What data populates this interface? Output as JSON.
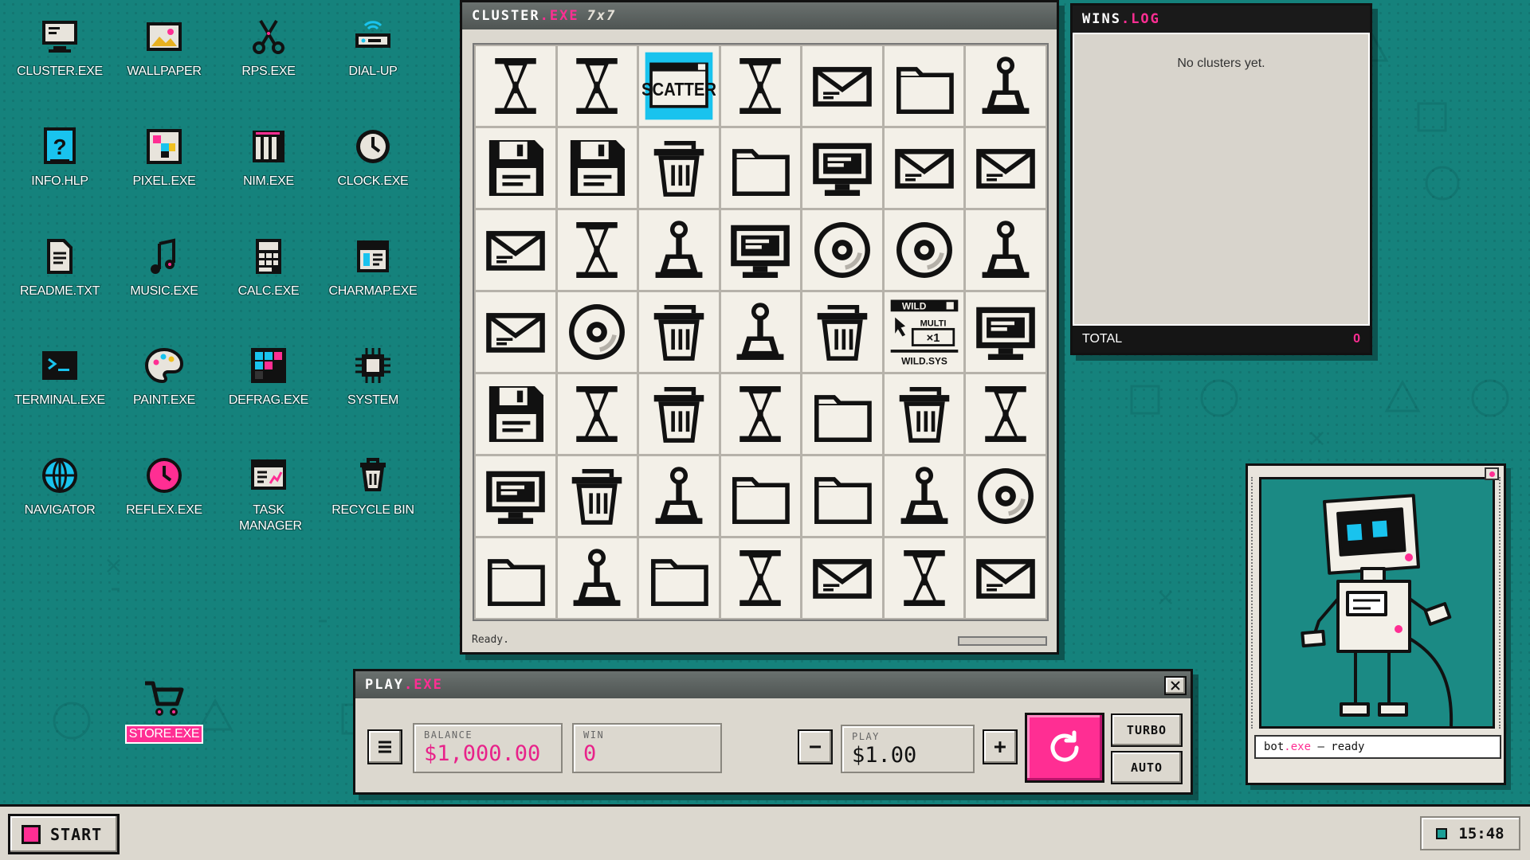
{
  "desktop": {
    "icons": [
      {
        "label": "CLUSTER.EXE",
        "icon": "monitor-icon"
      },
      {
        "label": "WALLPAPER",
        "icon": "image-icon"
      },
      {
        "label": "RPS.EXE",
        "icon": "scissors-icon"
      },
      {
        "label": "DIAL-UP",
        "icon": "modem-icon"
      },
      {
        "label": "INFO.HLP",
        "icon": "help-icon"
      },
      {
        "label": "PIXEL.EXE",
        "icon": "pixel-icon"
      },
      {
        "label": "NIM.EXE",
        "icon": "nim-icon"
      },
      {
        "label": "CLOCK.EXE",
        "icon": "clock-icon"
      },
      {
        "label": "README.TXT",
        "icon": "document-icon"
      },
      {
        "label": "MUSIC.EXE",
        "icon": "music-note-icon"
      },
      {
        "label": "CALC.EXE",
        "icon": "calculator-icon"
      },
      {
        "label": "CHARMAP.EXE",
        "icon": "charmap-icon"
      },
      {
        "label": "TERMINAL.EXE",
        "icon": "terminal-icon"
      },
      {
        "label": "PAINT.EXE",
        "icon": "palette-icon"
      },
      {
        "label": "DEFRAG.EXE",
        "icon": "defrag-icon"
      },
      {
        "label": "SYSTEM",
        "icon": "chip-icon"
      },
      {
        "label": "NAVIGATOR",
        "icon": "globe-icon"
      },
      {
        "label": "REFLEX.EXE",
        "icon": "reflex-clock-icon"
      },
      {
        "label": "TASK MANAGER",
        "icon": "task-manager-icon"
      },
      {
        "label": "RECYCLE BIN",
        "icon": "trash-icon"
      },
      {
        "label": "STORE.EXE",
        "icon": "cart-icon",
        "selected": true
      }
    ]
  },
  "cluster": {
    "title": "CLUSTER",
    "title_ext": ".EXE",
    "size_label": "7x7",
    "status": "Ready.",
    "symbols": {
      "scatter_label": "SCATTER",
      "wild_top": "WILD",
      "wild_multi": "MULTI",
      "wild_mult_value": "×1",
      "wild_bottom": "WILD.SYS"
    },
    "grid": [
      [
        "hourglass",
        "hourglass",
        "scatter",
        "hourglass",
        "mail",
        "folder",
        "joystick"
      ],
      [
        "floppy",
        "floppy",
        "trash",
        "folder",
        "monitor",
        "mail",
        "mail"
      ],
      [
        "mail",
        "hourglass",
        "joystick",
        "monitor",
        "cd",
        "cd",
        "joystick"
      ],
      [
        "mail",
        "cd",
        "trash",
        "joystick",
        "trash",
        "wild",
        "monitor"
      ],
      [
        "floppy",
        "hourglass",
        "trash",
        "hourglass",
        "folder",
        "trash",
        "hourglass"
      ],
      [
        "monitor",
        "trash",
        "joystick",
        "folder",
        "folder",
        "joystick",
        "cd"
      ],
      [
        "folder",
        "joystick",
        "folder",
        "hourglass",
        "mail",
        "hourglass",
        "mail"
      ]
    ],
    "highlight_color": "#19c3ee"
  },
  "wins": {
    "title": "WINS",
    "title_ext": ".LOG",
    "empty_text": "No clusters yet.",
    "total_label": "TOTAL",
    "total_value": "0"
  },
  "play": {
    "title": "PLAY",
    "title_ext": ".EXE",
    "close_icon": "close-icon",
    "menu_icon": "menu-icon",
    "balance_label": "BALANCE",
    "balance_value": "$1,000.00",
    "win_label": "WIN",
    "win_value": "0",
    "minus_label": "−",
    "plus_label": "+",
    "play_label": "PLAY",
    "play_value": "$1.00",
    "spin_icon": "refresh-icon",
    "turbo_label": "TURBO",
    "auto_label": "AUTO",
    "accent": "#ff2e93"
  },
  "bot": {
    "name": "bot",
    "ext": ".exe",
    "status": " – ready"
  },
  "taskbar": {
    "start_label": "START",
    "clock": "15:48"
  }
}
